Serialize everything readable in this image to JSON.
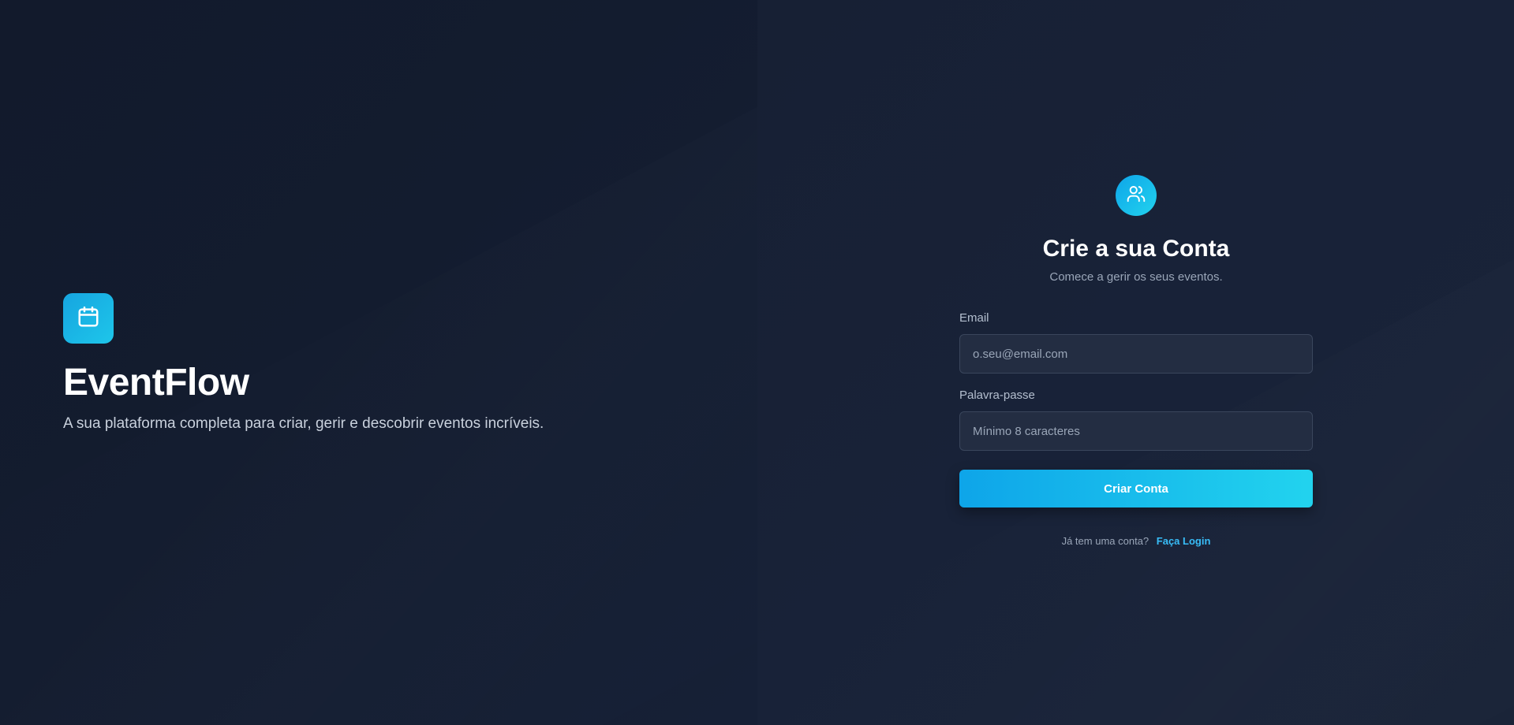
{
  "brand": {
    "name": "EventFlow",
    "tagline": "A sua plataforma completa para criar, gerir e descobrir eventos incríveis.",
    "icon": "calendar-icon"
  },
  "form": {
    "icon": "users-icon",
    "title": "Crie a sua Conta",
    "subtitle": "Comece a gerir os seus eventos.",
    "email_label": "Email",
    "email_placeholder": "o.seu@email.com",
    "email_value": "",
    "password_label": "Palavra-passe",
    "password_placeholder": "Mínimo 8 caracteres",
    "password_value": "",
    "submit_label": "Criar Conta",
    "login_prompt": "Já tem uma conta?",
    "login_link": "Faça Login"
  },
  "colors": {
    "accent_start": "#0ea5e9",
    "accent_end": "#22d3ee",
    "link": "#38bdf8",
    "left_bg": "#131c2f",
    "right_bg": "#182238"
  }
}
